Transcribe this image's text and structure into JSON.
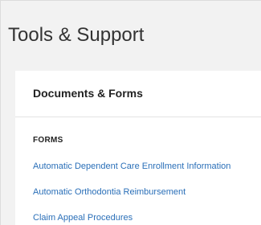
{
  "page": {
    "title": "Tools & Support"
  },
  "card": {
    "title": "Documents & Forms",
    "section_label": "FORMS",
    "links": [
      "Automatic Dependent Care Enrollment Information",
      "Automatic Orthodontia Reimbursement",
      "Claim Appeal Procedures"
    ]
  },
  "colors": {
    "background": "#f2f2f2",
    "card": "#ffffff",
    "link": "#2a6fb8",
    "text": "#222222"
  }
}
